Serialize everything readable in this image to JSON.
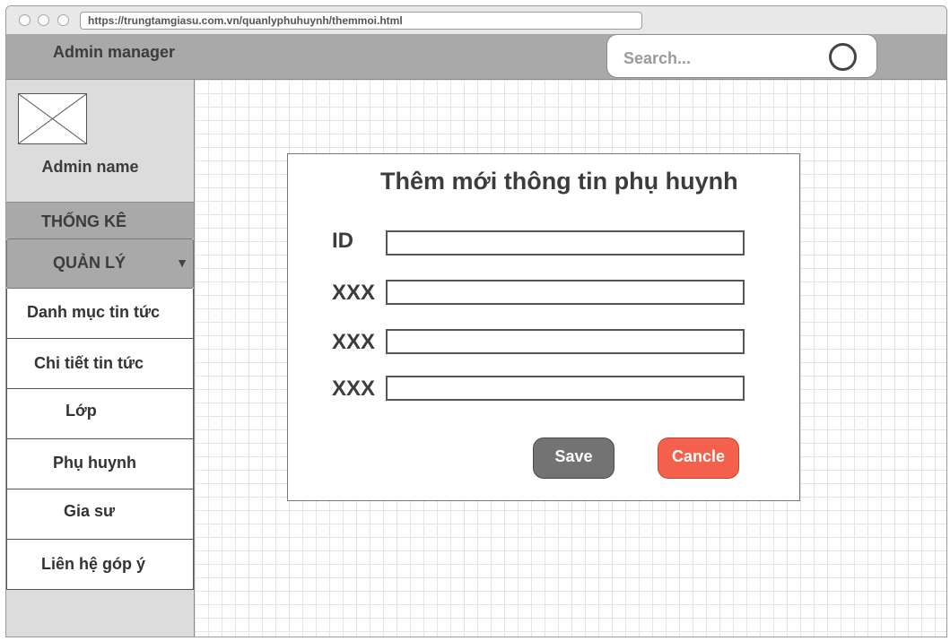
{
  "browser": {
    "url": "https://trungtamgiasu.com.vn/quanlyphuhuynh/themmoi.html"
  },
  "header": {
    "brand": "Admin manager",
    "search_placeholder": "Search..."
  },
  "sidebar": {
    "admin_name": "Admin name",
    "section_stats": "THỐNG KÊ",
    "section_manage": "QUẢN LÝ",
    "items": [
      {
        "label": "Danh mục tin tức"
      },
      {
        "label": "Chi tiết tin tức"
      },
      {
        "label": "Lớp"
      },
      {
        "label": "Phụ huynh"
      },
      {
        "label": "Gia sư"
      },
      {
        "label": "Liên hệ góp ý"
      }
    ]
  },
  "form": {
    "title": "Thêm mới thông tin phụ huynh",
    "fields": [
      {
        "label": "ID",
        "value": ""
      },
      {
        "label": "XXX",
        "value": ""
      },
      {
        "label": "XXX",
        "value": ""
      },
      {
        "label": "XXX",
        "value": ""
      }
    ],
    "save_label": "Save",
    "cancel_label": "Cancle"
  },
  "icons": {
    "dropdown": "chevron-down-icon",
    "search": "search-icon",
    "avatar": "image-placeholder-icon"
  },
  "colors": {
    "header_bg": "#a9a9a9",
    "save_button": "#737373",
    "cancel_button": "#f4604b"
  }
}
